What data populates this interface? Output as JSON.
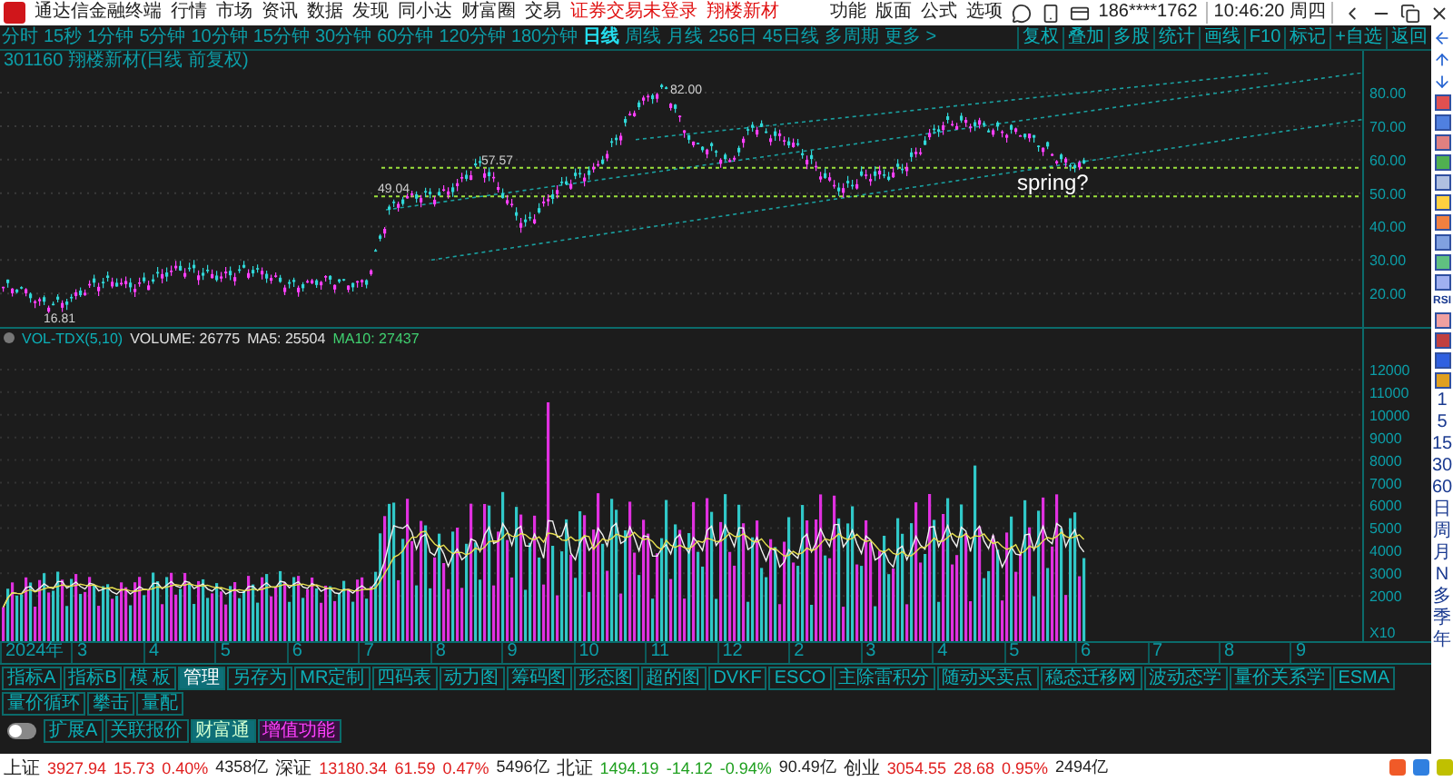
{
  "app": {
    "title": "通达信金融终端",
    "menu": [
      "行情",
      "市场",
      "资讯",
      "数据",
      "发现",
      "同小达",
      "财富圈",
      "交易"
    ],
    "login_status": "证券交易未登录",
    "stock_link": "翔楼新材",
    "right_menu": [
      "功能",
      "版面",
      "公式",
      "选项"
    ],
    "phone": "186****1762",
    "clock": "10:46:20 周四"
  },
  "periods": [
    {
      "label": "分时",
      "selected": false
    },
    {
      "label": "15秒",
      "selected": false
    },
    {
      "label": "1分钟",
      "selected": false
    },
    {
      "label": "5分钟",
      "selected": false
    },
    {
      "label": "10分钟",
      "selected": false
    },
    {
      "label": "15分钟",
      "selected": false
    },
    {
      "label": "30分钟",
      "selected": false
    },
    {
      "label": "60分钟",
      "selected": false
    },
    {
      "label": "120分钟",
      "selected": false
    },
    {
      "label": "180分钟",
      "selected": false
    },
    {
      "label": "日线",
      "selected": true
    },
    {
      "label": "周线",
      "selected": false
    },
    {
      "label": "月线",
      "selected": false
    },
    {
      "label": "256日",
      "selected": false
    },
    {
      "label": "45日线",
      "selected": false
    },
    {
      "label": "多周期",
      "selected": false
    },
    {
      "label": "更多 >",
      "selected": false
    }
  ],
  "toolbar": [
    "复权",
    "叠加",
    "多股",
    "统计",
    "画线",
    "F10",
    "标记",
    "+自选",
    "返回"
  ],
  "price_chart": {
    "title": "301160 翔楼新材(日线 前复权)",
    "axis_labels": [
      "80.00",
      "70.00",
      "60.00",
      "50.00",
      "40.00",
      "30.00",
      "20.00"
    ],
    "annotations": [
      "82.00",
      "57.57",
      "49.04",
      "16.81"
    ],
    "note": "spring?"
  },
  "volume_chart": {
    "indicator": "VOL-TDX(5,10)",
    "readings": [
      {
        "label": "VOLUME: 26775",
        "color": "#e0e0e0"
      },
      {
        "label": "MA5: 25504",
        "color": "#e0e0e0"
      },
      {
        "label": "MA10: 27437",
        "color": "#40d070"
      }
    ],
    "axis_labels": [
      "12000",
      "11000",
      "10000",
      "9000",
      "8000",
      "7000",
      "6000",
      "5000",
      "4000",
      "3000",
      "2000"
    ],
    "scale": "X10"
  },
  "months": [
    "2024年",
    "3",
    "4",
    "5",
    "6",
    "7",
    "8",
    "9",
    "10",
    "11",
    "12",
    "2",
    "3",
    "4",
    "5",
    "6",
    "7",
    "8",
    "9"
  ],
  "indicator_tabs": [
    {
      "label": "指标A",
      "selected": false
    },
    {
      "label": "指标B",
      "selected": false
    },
    {
      "label": "模 板",
      "selected": false
    },
    {
      "label": "管理",
      "selected": true
    },
    {
      "label": "另存为",
      "selected": false
    },
    {
      "label": "MR定制",
      "selected": false
    },
    {
      "label": "四码表",
      "selected": false
    },
    {
      "label": "动力图",
      "selected": false
    },
    {
      "label": "筹码图",
      "selected": false
    },
    {
      "label": "形态图",
      "selected": false
    },
    {
      "label": "超的图",
      "selected": false
    },
    {
      "label": "DVKF",
      "selected": false
    },
    {
      "label": "ESCO",
      "selected": false
    },
    {
      "label": "主除雷积分",
      "selected": false
    },
    {
      "label": "随动买卖点",
      "selected": false
    },
    {
      "label": "稳态迁移网",
      "selected": false
    },
    {
      "label": "波动态学",
      "selected": false
    },
    {
      "label": "量价关系学",
      "selected": false
    },
    {
      "label": "ESMA",
      "selected": false
    },
    {
      "label": "量价循环",
      "selected": false
    },
    {
      "label": "攀击",
      "selected": false
    },
    {
      "label": "量配",
      "selected": false
    }
  ],
  "switch": {
    "on": false
  },
  "extra_tabs": [
    {
      "label": "扩展A",
      "kind": "plain"
    },
    {
      "label": "关联报价",
      "kind": "plain"
    },
    {
      "label": "财富通",
      "kind": "highlight"
    },
    {
      "label": "增值功能",
      "kind": "promo"
    }
  ],
  "status_bar": {
    "indices": [
      {
        "name": "上证",
        "value": "3927.94",
        "change": "15.73",
        "percent": "0.40%",
        "amount": "4358亿",
        "color": "#e02020"
      },
      {
        "name": "深证",
        "value": "13180.34",
        "change": "61.59",
        "percent": "0.47%",
        "amount": "5496亿",
        "color": "#e02020"
      },
      {
        "name": "北证",
        "value": "1494.19",
        "change": "-14.12",
        "percent": "-0.94%",
        "amount": "90.49亿",
        "color": "#20a020"
      },
      {
        "name": "创业",
        "value": "3054.55",
        "change": "28.68",
        "percent": "0.95%",
        "amount": "2494亿",
        "color": "#e02020"
      }
    ]
  },
  "sidebar": {
    "labels": [
      "RSI"
    ],
    "periods": [
      "1",
      "5",
      "15",
      "30",
      "60",
      "日",
      "周",
      "月",
      "N",
      "多",
      "季",
      "年"
    ]
  }
}
